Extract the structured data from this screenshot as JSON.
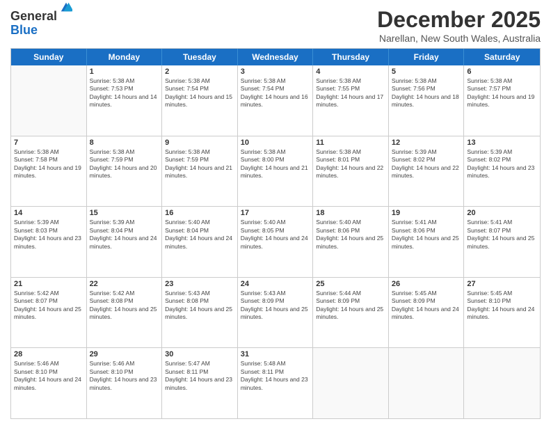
{
  "logo": {
    "general": "General",
    "blue": "Blue"
  },
  "title": "December 2025",
  "subtitle": "Narellan, New South Wales, Australia",
  "headers": [
    "Sunday",
    "Monday",
    "Tuesday",
    "Wednesday",
    "Thursday",
    "Friday",
    "Saturday"
  ],
  "weeks": [
    [
      {
        "day": "",
        "sunrise": "",
        "sunset": "",
        "daylight": ""
      },
      {
        "day": "1",
        "sunrise": "Sunrise: 5:38 AM",
        "sunset": "Sunset: 7:53 PM",
        "daylight": "Daylight: 14 hours and 14 minutes."
      },
      {
        "day": "2",
        "sunrise": "Sunrise: 5:38 AM",
        "sunset": "Sunset: 7:54 PM",
        "daylight": "Daylight: 14 hours and 15 minutes."
      },
      {
        "day": "3",
        "sunrise": "Sunrise: 5:38 AM",
        "sunset": "Sunset: 7:54 PM",
        "daylight": "Daylight: 14 hours and 16 minutes."
      },
      {
        "day": "4",
        "sunrise": "Sunrise: 5:38 AM",
        "sunset": "Sunset: 7:55 PM",
        "daylight": "Daylight: 14 hours and 17 minutes."
      },
      {
        "day": "5",
        "sunrise": "Sunrise: 5:38 AM",
        "sunset": "Sunset: 7:56 PM",
        "daylight": "Daylight: 14 hours and 18 minutes."
      },
      {
        "day": "6",
        "sunrise": "Sunrise: 5:38 AM",
        "sunset": "Sunset: 7:57 PM",
        "daylight": "Daylight: 14 hours and 19 minutes."
      }
    ],
    [
      {
        "day": "7",
        "sunrise": "Sunrise: 5:38 AM",
        "sunset": "Sunset: 7:58 PM",
        "daylight": "Daylight: 14 hours and 19 minutes."
      },
      {
        "day": "8",
        "sunrise": "Sunrise: 5:38 AM",
        "sunset": "Sunset: 7:59 PM",
        "daylight": "Daylight: 14 hours and 20 minutes."
      },
      {
        "day": "9",
        "sunrise": "Sunrise: 5:38 AM",
        "sunset": "Sunset: 7:59 PM",
        "daylight": "Daylight: 14 hours and 21 minutes."
      },
      {
        "day": "10",
        "sunrise": "Sunrise: 5:38 AM",
        "sunset": "Sunset: 8:00 PM",
        "daylight": "Daylight: 14 hours and 21 minutes."
      },
      {
        "day": "11",
        "sunrise": "Sunrise: 5:38 AM",
        "sunset": "Sunset: 8:01 PM",
        "daylight": "Daylight: 14 hours and 22 minutes."
      },
      {
        "day": "12",
        "sunrise": "Sunrise: 5:39 AM",
        "sunset": "Sunset: 8:02 PM",
        "daylight": "Daylight: 14 hours and 22 minutes."
      },
      {
        "day": "13",
        "sunrise": "Sunrise: 5:39 AM",
        "sunset": "Sunset: 8:02 PM",
        "daylight": "Daylight: 14 hours and 23 minutes."
      }
    ],
    [
      {
        "day": "14",
        "sunrise": "Sunrise: 5:39 AM",
        "sunset": "Sunset: 8:03 PM",
        "daylight": "Daylight: 14 hours and 23 minutes."
      },
      {
        "day": "15",
        "sunrise": "Sunrise: 5:39 AM",
        "sunset": "Sunset: 8:04 PM",
        "daylight": "Daylight: 14 hours and 24 minutes."
      },
      {
        "day": "16",
        "sunrise": "Sunrise: 5:40 AM",
        "sunset": "Sunset: 8:04 PM",
        "daylight": "Daylight: 14 hours and 24 minutes."
      },
      {
        "day": "17",
        "sunrise": "Sunrise: 5:40 AM",
        "sunset": "Sunset: 8:05 PM",
        "daylight": "Daylight: 14 hours and 24 minutes."
      },
      {
        "day": "18",
        "sunrise": "Sunrise: 5:40 AM",
        "sunset": "Sunset: 8:06 PM",
        "daylight": "Daylight: 14 hours and 25 minutes."
      },
      {
        "day": "19",
        "sunrise": "Sunrise: 5:41 AM",
        "sunset": "Sunset: 8:06 PM",
        "daylight": "Daylight: 14 hours and 25 minutes."
      },
      {
        "day": "20",
        "sunrise": "Sunrise: 5:41 AM",
        "sunset": "Sunset: 8:07 PM",
        "daylight": "Daylight: 14 hours and 25 minutes."
      }
    ],
    [
      {
        "day": "21",
        "sunrise": "Sunrise: 5:42 AM",
        "sunset": "Sunset: 8:07 PM",
        "daylight": "Daylight: 14 hours and 25 minutes."
      },
      {
        "day": "22",
        "sunrise": "Sunrise: 5:42 AM",
        "sunset": "Sunset: 8:08 PM",
        "daylight": "Daylight: 14 hours and 25 minutes."
      },
      {
        "day": "23",
        "sunrise": "Sunrise: 5:43 AM",
        "sunset": "Sunset: 8:08 PM",
        "daylight": "Daylight: 14 hours and 25 minutes."
      },
      {
        "day": "24",
        "sunrise": "Sunrise: 5:43 AM",
        "sunset": "Sunset: 8:09 PM",
        "daylight": "Daylight: 14 hours and 25 minutes."
      },
      {
        "day": "25",
        "sunrise": "Sunrise: 5:44 AM",
        "sunset": "Sunset: 8:09 PM",
        "daylight": "Daylight: 14 hours and 25 minutes."
      },
      {
        "day": "26",
        "sunrise": "Sunrise: 5:45 AM",
        "sunset": "Sunset: 8:09 PM",
        "daylight": "Daylight: 14 hours and 24 minutes."
      },
      {
        "day": "27",
        "sunrise": "Sunrise: 5:45 AM",
        "sunset": "Sunset: 8:10 PM",
        "daylight": "Daylight: 14 hours and 24 minutes."
      }
    ],
    [
      {
        "day": "28",
        "sunrise": "Sunrise: 5:46 AM",
        "sunset": "Sunset: 8:10 PM",
        "daylight": "Daylight: 14 hours and 24 minutes."
      },
      {
        "day": "29",
        "sunrise": "Sunrise: 5:46 AM",
        "sunset": "Sunset: 8:10 PM",
        "daylight": "Daylight: 14 hours and 23 minutes."
      },
      {
        "day": "30",
        "sunrise": "Sunrise: 5:47 AM",
        "sunset": "Sunset: 8:11 PM",
        "daylight": "Daylight: 14 hours and 23 minutes."
      },
      {
        "day": "31",
        "sunrise": "Sunrise: 5:48 AM",
        "sunset": "Sunset: 8:11 PM",
        "daylight": "Daylight: 14 hours and 23 minutes."
      },
      {
        "day": "",
        "sunrise": "",
        "sunset": "",
        "daylight": ""
      },
      {
        "day": "",
        "sunrise": "",
        "sunset": "",
        "daylight": ""
      },
      {
        "day": "",
        "sunrise": "",
        "sunset": "",
        "daylight": ""
      }
    ]
  ]
}
